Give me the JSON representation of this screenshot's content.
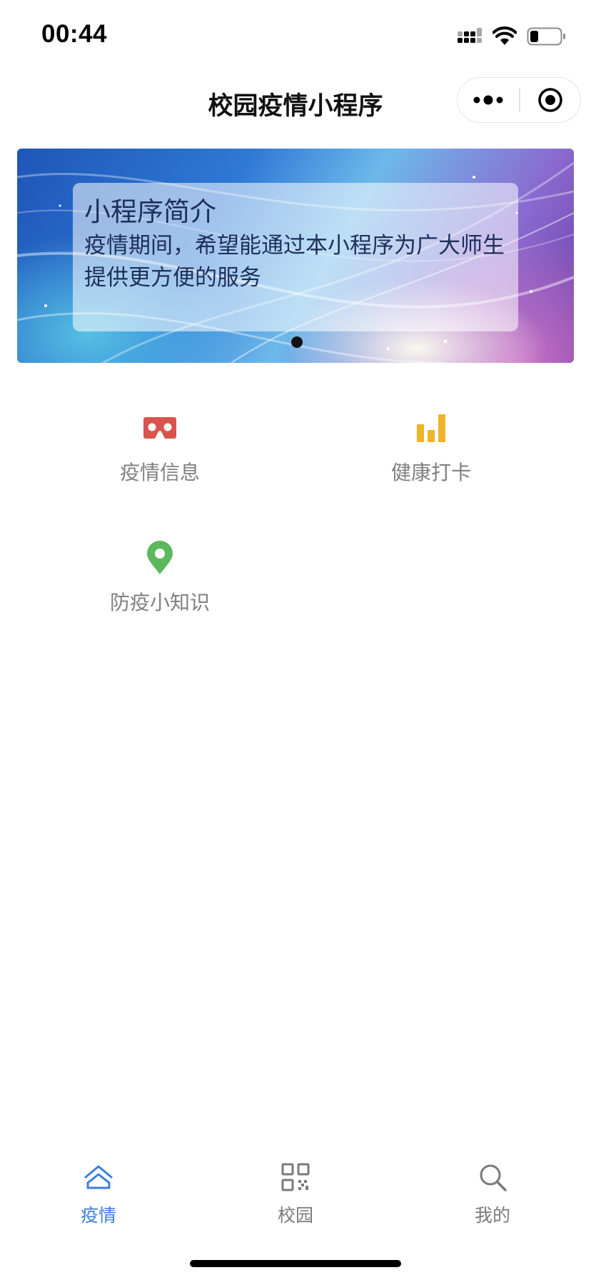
{
  "status_bar": {
    "time": "00:44",
    "icons": [
      "signal-icon",
      "wifi-icon",
      "battery-icon"
    ]
  },
  "nav": {
    "title": "校园疫情小程序",
    "capsule_icons": [
      "more-icon",
      "close-circle-icon"
    ]
  },
  "banner": {
    "title": "小程序简介",
    "text": "疫情期间，希望能通过本小程序为广大师生提供更方便的服务",
    "dots": 1,
    "active_dot": 0
  },
  "menu": [
    {
      "label": "疫情信息",
      "icon": "vr-glasses-icon",
      "color": "#d9534f"
    },
    {
      "label": "健康打卡",
      "icon": "bar-chart-icon",
      "color": "#f0b429"
    },
    {
      "label": "防疫小知识",
      "icon": "location-pin-icon",
      "color": "#5cb85c"
    }
  ],
  "tab_bar": {
    "active_color": "#3b7fd9",
    "inactive_color": "#7a7a7a",
    "tabs": [
      {
        "label": "疫情",
        "icon": "home-icon",
        "active": true
      },
      {
        "label": "校园",
        "icon": "qrcode-icon",
        "active": false
      },
      {
        "label": "我的",
        "icon": "search-icon",
        "active": false
      }
    ]
  }
}
